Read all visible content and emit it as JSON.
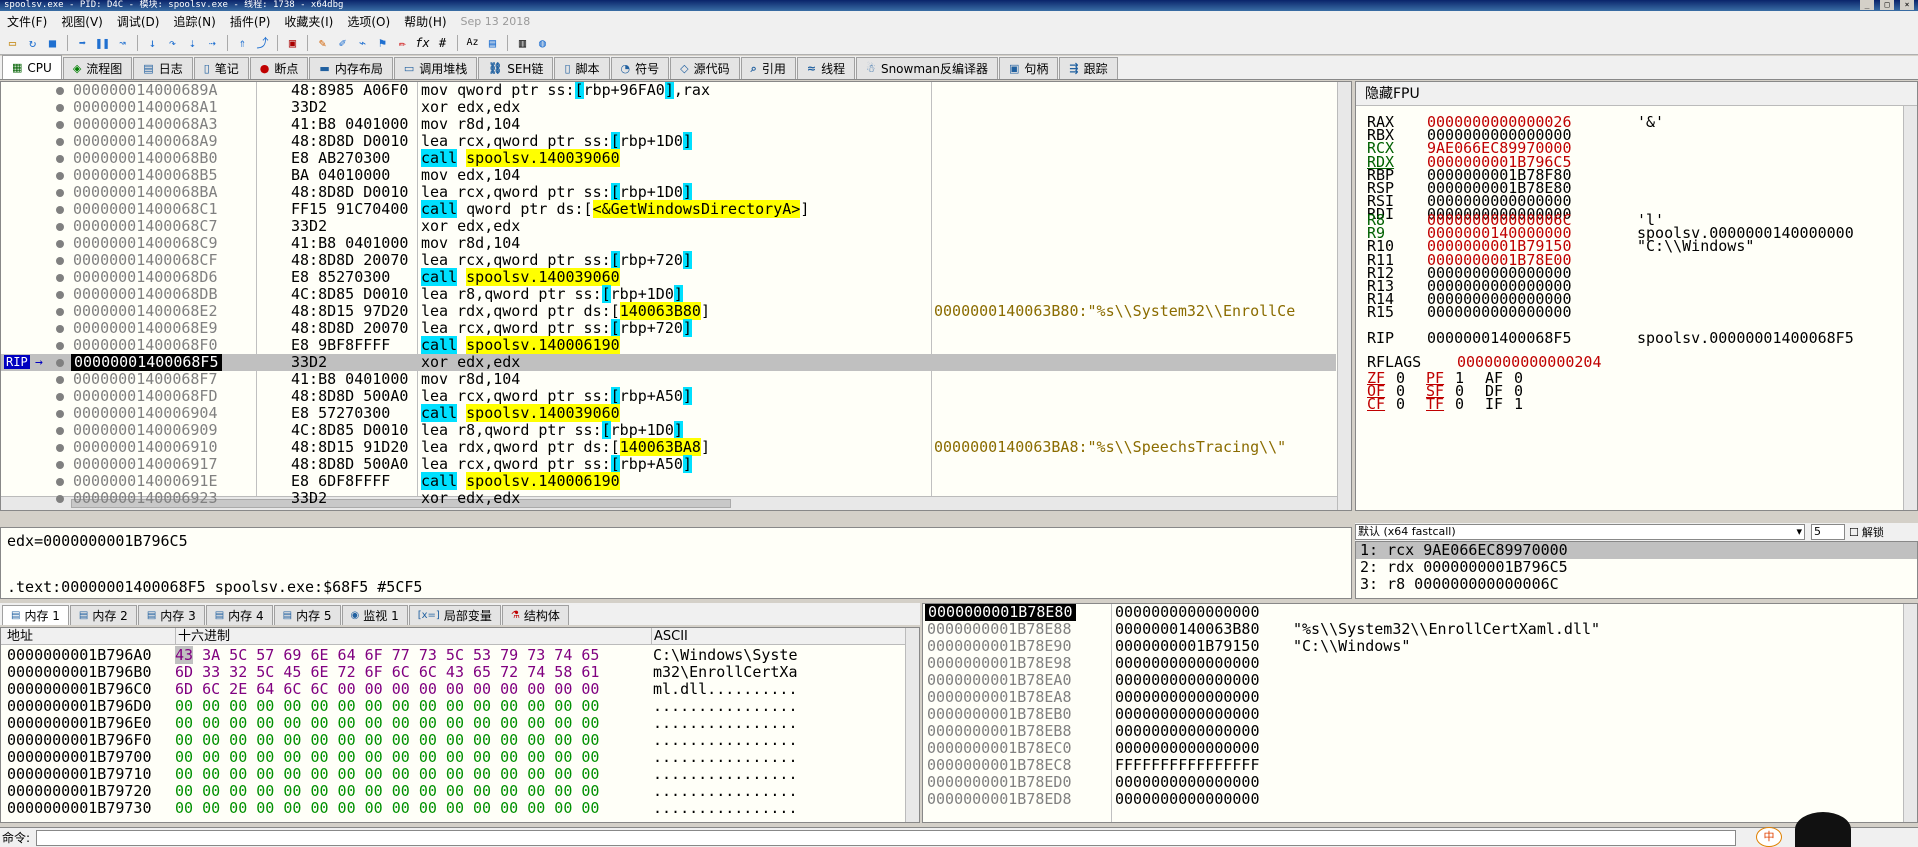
{
  "window": {
    "title": "spoolsv.exe - PID: D4C - 模块: spoolsv.exe - 线程: 1738 - x64dbg"
  },
  "menu": [
    "文件(F)",
    "视图(V)",
    "调试(D)",
    "追踪(N)",
    "插件(P)",
    "收藏夹(I)",
    "选项(O)",
    "帮助(H)"
  ],
  "build_date": "Sep 13 2018",
  "tabs": [
    {
      "label": "CPU",
      "icon": "cpu-icon"
    },
    {
      "label": "流程图",
      "icon": "graph-icon"
    },
    {
      "label": "日志",
      "icon": "log-icon"
    },
    {
      "label": "笔记",
      "icon": "notes-icon"
    },
    {
      "label": "断点",
      "icon": "breakpoint-icon"
    },
    {
      "label": "内存布局",
      "icon": "memory-map-icon"
    },
    {
      "label": "调用堆栈",
      "icon": "call-stack-icon"
    },
    {
      "label": "SEH链",
      "icon": "seh-icon"
    },
    {
      "label": "脚本",
      "icon": "script-icon"
    },
    {
      "label": "符号",
      "icon": "symbols-icon"
    },
    {
      "label": "源代码",
      "icon": "source-icon"
    },
    {
      "label": "引用",
      "icon": "references-icon"
    },
    {
      "label": "线程",
      "icon": "threads-icon"
    },
    {
      "label": "Snowman反编译器",
      "icon": "snowman-icon"
    },
    {
      "label": "句柄",
      "icon": "handles-icon"
    },
    {
      "label": "跟踪",
      "icon": "trace-icon"
    }
  ],
  "disasm": [
    {
      "addr": "000000014000689A",
      "bytes": "48:8985 A06F0",
      "pre": "mov qword ptr ss:",
      "op": "[rbp+96FA0]",
      "post": ",rax",
      "kind": "mem"
    },
    {
      "addr": "00000001400068A1",
      "bytes": "33D2",
      "pre": "xor edx,edx",
      "kind": "plain"
    },
    {
      "addr": "00000001400068A3",
      "bytes": "41:B8 0401000",
      "pre": "mov r8d,104",
      "kind": "plain"
    },
    {
      "addr": "00000001400068A9",
      "bytes": "48:8D8D D0010",
      "pre": "lea rcx,qword ptr ss:",
      "op": "[rbp+1D0]",
      "post": "",
      "kind": "mem"
    },
    {
      "addr": "00000001400068B0",
      "bytes": "E8 AB270300",
      "call": "call",
      "target": "spoolsv.140039060",
      "kind": "call"
    },
    {
      "addr": "00000001400068B5",
      "bytes": "BA 04010000",
      "pre": "mov edx,104",
      "kind": "plain"
    },
    {
      "addr": "00000001400068BA",
      "bytes": "48:8D8D D0010",
      "pre": "lea rcx,qword ptr ss:",
      "op": "[rbp+1D0]",
      "post": "",
      "kind": "mem"
    },
    {
      "addr": "00000001400068C1",
      "bytes": "FF15 91C70400",
      "call": "call",
      "mid": " qword ptr ds:[",
      "target": "<&GetWindowsDirectoryA>",
      "end": "]",
      "kind": "calli"
    },
    {
      "addr": "00000001400068C7",
      "bytes": "33D2",
      "pre": "xor edx,edx",
      "kind": "plain"
    },
    {
      "addr": "00000001400068C9",
      "bytes": "41:B8 0401000",
      "pre": "mov r8d,104",
      "kind": "plain"
    },
    {
      "addr": "00000001400068CF",
      "bytes": "48:8D8D 20070",
      "pre": "lea rcx,qword ptr ss:",
      "op": "[rbp+720]",
      "post": "",
      "kind": "mem"
    },
    {
      "addr": "00000001400068D6",
      "bytes": "E8 85270300",
      "call": "call",
      "target": "spoolsv.140039060",
      "kind": "call"
    },
    {
      "addr": "00000001400068DB",
      "bytes": "4C:8D85 D0010",
      "pre": "lea r8,qword ptr ss:",
      "op": "[rbp+1D0]",
      "post": "",
      "kind": "mem"
    },
    {
      "addr": "00000001400068E2",
      "bytes": "48:8D15 97D20",
      "pre": "lea rdx,qword ptr ds:[",
      "imm": "140063B80",
      "post": "]",
      "comment": "0000000140063B80:\"%s\\\\System32\\\\EnrollCe",
      "kind": "imm"
    },
    {
      "addr": "00000001400068E9",
      "bytes": "48:8D8D 20070",
      "pre": "lea rcx,qword ptr ss:",
      "op": "[rbp+720]",
      "post": "",
      "kind": "mem"
    },
    {
      "addr": "00000001400068F0",
      "bytes": "E8 9BF8FFFF",
      "call": "call",
      "target": "spoolsv.140006190",
      "kind": "call"
    },
    {
      "addr": "00000001400068F5",
      "bytes": "33D2",
      "pre": "xor edx,edx",
      "kind": "plain",
      "rip": true
    },
    {
      "addr": "00000001400068F7",
      "bytes": "41:B8 0401000",
      "pre": "mov r8d,104",
      "kind": "plain"
    },
    {
      "addr": "00000001400068FD",
      "bytes": "48:8D8D 500A0",
      "pre": "lea rcx,qword ptr ss:",
      "op": "[rbp+A50]",
      "post": "",
      "kind": "mem"
    },
    {
      "addr": "0000000140006904",
      "bytes": "E8 57270300",
      "call": "call",
      "target": "spoolsv.140039060",
      "kind": "call"
    },
    {
      "addr": "0000000140006909",
      "bytes": "4C:8D85 D0010",
      "pre": "lea r8,qword ptr ss:",
      "op": "[rbp+1D0]",
      "post": "",
      "kind": "mem"
    },
    {
      "addr": "0000000140006910",
      "bytes": "48:8D15 91D20",
      "pre": "lea rdx,qword ptr ds:[",
      "imm": "140063BA8",
      "post": "]",
      "comment": "0000000140063BA8:\"%s\\\\SpeechsTracing\\\\\"",
      "kind": "imm"
    },
    {
      "addr": "0000000140006917",
      "bytes": "48:8D8D 500A0",
      "pre": "lea rcx,qword ptr ss:",
      "op": "[rbp+A50]",
      "post": "",
      "kind": "mem"
    },
    {
      "addr": "000000014000691E",
      "bytes": "E8 6DF8FFFF",
      "call": "call",
      "target": "spoolsv.140006190",
      "kind": "call"
    },
    {
      "addr": "0000000140006923",
      "bytes": "33D2",
      "pre": "xor edx,edx",
      "kind": "plain"
    }
  ],
  "rip_label": "RIP",
  "fpu_title": "隐藏FPU",
  "registers": [
    {
      "name": "RAX",
      "value": "0000000000000026",
      "extra": "'&'",
      "color": "red"
    },
    {
      "name": "RBX",
      "value": "0000000000000000",
      "extra": ""
    },
    {
      "name": "RCX",
      "value": "9AE066EC89970000",
      "extra": "",
      "color": "red",
      "ncolor": "green"
    },
    {
      "name": "RDX",
      "value": "0000000001B796C5",
      "extra": "",
      "color": "red",
      "ncolor": "green",
      "underline": true
    },
    {
      "name": "RBP",
      "value": "0000000001B78F80",
      "extra": ""
    },
    {
      "name": "RSP",
      "value": "0000000001B78E80",
      "extra": ""
    },
    {
      "name": "RSI",
      "value": "0000000000000000",
      "extra": ""
    },
    {
      "name": "RDI",
      "value": "0000000000000000",
      "extra": ""
    }
  ],
  "registers2": [
    {
      "name": "R8",
      "value": "000000000000006C",
      "extra": "'l'",
      "color": "red",
      "ncolor": "green"
    },
    {
      "name": "R9",
      "value": "0000000140000000",
      "extra": "spoolsv.0000000140000000",
      "color": "red",
      "ncolor": "green"
    },
    {
      "name": "R10",
      "value": "0000000001B79150",
      "extra": "\"C:\\\\Windows\"",
      "color": "red"
    },
    {
      "name": "R11",
      "value": "0000000001B78E00",
      "extra": "",
      "color": "red"
    },
    {
      "name": "R12",
      "value": "0000000000000000",
      "extra": ""
    },
    {
      "name": "R13",
      "value": "0000000000000000",
      "extra": ""
    },
    {
      "name": "R14",
      "value": "0000000000000000",
      "extra": ""
    },
    {
      "name": "R15",
      "value": "0000000000000000",
      "extra": ""
    }
  ],
  "rip_reg": {
    "name": "RIP",
    "value": "00000001400068F5",
    "extra": "spoolsv.00000001400068F5"
  },
  "rflags": {
    "name": "RFLAGS",
    "value": "0000000000000204"
  },
  "flags": [
    [
      "ZF",
      "0",
      "PF",
      "1",
      "AF",
      "0"
    ],
    [
      "OF",
      "0",
      "SF",
      "0",
      "DF",
      "0"
    ],
    [
      "CF",
      "0",
      "TF",
      "0",
      "IF",
      "1"
    ]
  ],
  "callconv": {
    "label": "默认 (x64 fastcall)",
    "count": "5",
    "unlock": "解锁"
  },
  "args": [
    "1: rcx 9AE066EC89970000",
    "2: rdx 0000000001B796C5",
    "3: r8 000000000000006C"
  ],
  "info": {
    "line1": "edx=0000000001B796C5",
    "line2": ".text:00000001400068F5 spoolsv.exe:$68F5 #5CF5"
  },
  "bottom_tabs": [
    {
      "label": "内存 1",
      "icon": "memory-icon"
    },
    {
      "label": "内存 2",
      "icon": "memory-icon"
    },
    {
      "label": "内存 3",
      "icon": "memory-icon"
    },
    {
      "label": "内存 4",
      "icon": "memory-icon"
    },
    {
      "label": "内存 5",
      "icon": "memory-icon"
    },
    {
      "label": "监视 1",
      "icon": "watch-icon"
    },
    {
      "label": "局部变量",
      "icon": "locals-icon"
    },
    {
      "label": "结构体",
      "icon": "struct-icon"
    }
  ],
  "dump_headers": {
    "addr": "地址",
    "hex": "十六进制",
    "ascii": "ASCII"
  },
  "dump": [
    {
      "addr": "0000000001B796A0",
      "hex": "43 3A 5C 57 69 6E 64 6F 77 73 5C 53 79 73 74 65",
      "ascii": "C:\\Windows\\Syste"
    },
    {
      "addr": "0000000001B796B0",
      "hex": "6D 33 32 5C 45 6E 72 6F 6C 6C 43 65 72 74 58 61",
      "ascii": "m32\\EnrollCertXa"
    },
    {
      "addr": "0000000001B796C0",
      "hex": "6D 6C 2E 64 6C 6C 00 00 00 00 00 00 00 00 00 00",
      "ascii": "ml.dll.........."
    },
    {
      "addr": "0000000001B796D0",
      "hex": "00 00 00 00 00 00 00 00 00 00 00 00 00 00 00 00",
      "ascii": "................"
    },
    {
      "addr": "0000000001B796E0",
      "hex": "00 00 00 00 00 00 00 00 00 00 00 00 00 00 00 00",
      "ascii": "................"
    },
    {
      "addr": "0000000001B796F0",
      "hex": "00 00 00 00 00 00 00 00 00 00 00 00 00 00 00 00",
      "ascii": "................"
    },
    {
      "addr": "0000000001B79700",
      "hex": "00 00 00 00 00 00 00 00 00 00 00 00 00 00 00 00",
      "ascii": "................"
    },
    {
      "addr": "0000000001B79710",
      "hex": "00 00 00 00 00 00 00 00 00 00 00 00 00 00 00 00",
      "ascii": "................"
    },
    {
      "addr": "0000000001B79720",
      "hex": "00 00 00 00 00 00 00 00 00 00 00 00 00 00 00 00",
      "ascii": "................"
    },
    {
      "addr": "0000000001B79730",
      "hex": "00 00 00 00 00 00 00 00 00 00 00 00 00 00 00 00",
      "ascii": "................"
    }
  ],
  "stack": [
    {
      "addr": "0000000001B78E80",
      "value": "0000000000000000",
      "comment": "",
      "top": true
    },
    {
      "addr": "0000000001B78E88",
      "value": "0000000140063B80",
      "comment": "\"%s\\\\System32\\\\EnrollCertXaml.dll\""
    },
    {
      "addr": "0000000001B78E90",
      "value": "0000000001B79150",
      "comment": "\"C:\\\\Windows\""
    },
    {
      "addr": "0000000001B78E98",
      "value": "0000000000000000",
      "comment": ""
    },
    {
      "addr": "0000000001B78EA0",
      "value": "0000000000000000",
      "comment": ""
    },
    {
      "addr": "0000000001B78EA8",
      "value": "0000000000000000",
      "comment": ""
    },
    {
      "addr": "0000000001B78EB0",
      "value": "0000000000000000",
      "comment": ""
    },
    {
      "addr": "0000000001B78EB8",
      "value": "0000000000000000",
      "comment": ""
    },
    {
      "addr": "0000000001B78EC0",
      "value": "0000000000000000",
      "comment": ""
    },
    {
      "addr": "0000000001B78EC8",
      "value": "FFFFFFFFFFFFFFFF",
      "comment": ""
    },
    {
      "addr": "0000000001B78ED0",
      "value": "0000000000000000",
      "comment": ""
    },
    {
      "addr": "0000000001B78ED8",
      "value": "0000000000000000",
      "comment": ""
    }
  ],
  "command_label": "命令:",
  "ime_label": "中"
}
